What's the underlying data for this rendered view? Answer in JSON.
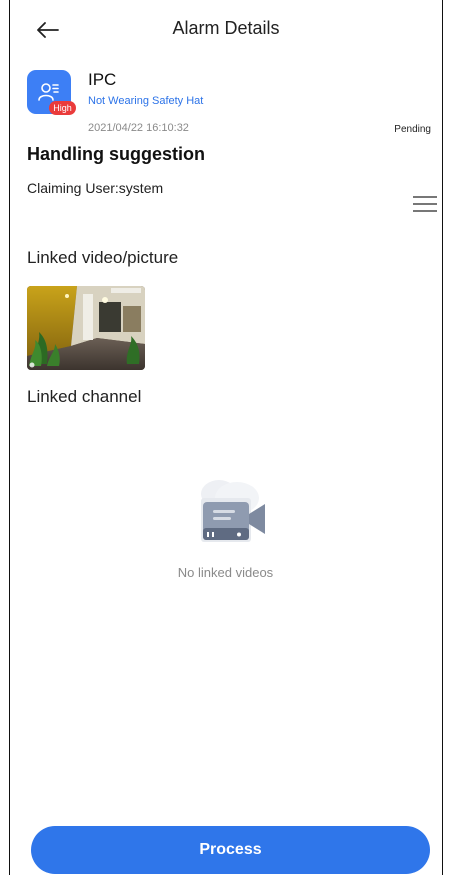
{
  "header": {
    "title": "Alarm Details",
    "back_icon": "arrow-left-icon"
  },
  "alarm": {
    "device_name": "IPC",
    "device_icon": "person-alarm-icon",
    "level_badge": "High",
    "type": "Not Wearing Safety Hat",
    "time": "2021/04/22 16:10:32",
    "status": "Pending"
  },
  "handling": {
    "heading": "Handling suggestion",
    "claiming_user": "Claiming User:system",
    "menu_icon": "hamburger-menu-icon"
  },
  "linked_media": {
    "heading": "Linked video/picture",
    "thumbnail_icon": "alarm-snapshot-thumbnail"
  },
  "linked_channel": {
    "heading": "Linked channel",
    "empty_icon": "video-camera-icon",
    "empty_text": "No linked videos"
  },
  "footer": {
    "process_label": "Process"
  },
  "colors": {
    "primary": "#2f76ea",
    "badge_red": "#ea3b3b",
    "device_icon_bg": "#3d7ff5"
  }
}
